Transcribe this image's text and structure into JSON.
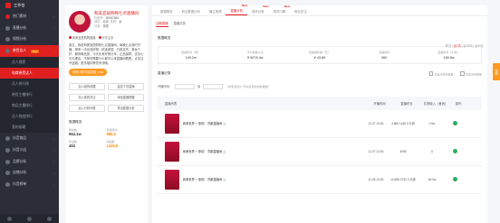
{
  "nav": {
    "title": "工作台",
    "items": [
      {
        "label": "热门素材"
      },
      {
        "label": "直播分析"
      },
      {
        "label": "视频分析"
      },
      {
        "label": "带货达人",
        "tag": "New",
        "active": true
      },
      {
        "label": "达人搜索",
        "sub": true
      },
      {
        "label": "电商带货达人",
        "sub": true,
        "active": true
      },
      {
        "label": "达人排行榜",
        "sub": true
      },
      {
        "label": "带货主播排行",
        "sub": true
      },
      {
        "label": "商品主播排行",
        "sub": true
      },
      {
        "label": "达人热度排行",
        "sub": true
      },
      {
        "label": "我的收藏",
        "sub": true
      },
      {
        "label": "抖音商品"
      },
      {
        "label": "抖音小店"
      },
      {
        "label": "品牌分析"
      },
      {
        "label": "店铺分析"
      },
      {
        "label": "抖音榜单"
      }
    ]
  },
  "profile": {
    "name": "和美宜居购物七点直播间",
    "id_label": "抖音号：",
    "id": "80987888",
    "area_label": "地区：",
    "area": "北京",
    "fans_label": "性别：",
    "fans": "女",
    "type_label": "分类：",
    "type": "家居",
    "quick": [
      "和美宜居购物直播",
      "分享主页"
    ]
  },
  "desc": "各位，我是和美宜居购物七点直播间。每晚七点准时开播，带来一手优选好物，精选家居、日用百货、美妆个护、服饰等品类，今天也有好物分享，正品保障，支持七天无理由，不管您需要什么都可以来直播间看看，点关注不迷路，更多福利等您来领哦。",
  "badge": "带货口碑 商品总数 1.3w",
  "actions": [
    "加入我的收藏",
    "监控下次直播",
    "加入我的关注",
    "添加直播提醒",
    "加入分析列表",
    "导出数据分析"
  ],
  "stats": {
    "title": "数据概览",
    "items": [
      {
        "k": "粉丝数",
        "v": "964.1w",
        "o": false
      },
      {
        "k": "直播场次",
        "v": "886.0",
        "o": true
      },
      {
        "k": "作品数",
        "v": "453",
        "o": false
      },
      {
        "k": "商品数",
        "v": "1426.9",
        "o": true
      }
    ]
  },
  "tabs": [
    {
      "label": "数据概览"
    },
    {
      "label": "粉丝数据分析"
    },
    {
      "label": "播主视频"
    },
    {
      "label": "直播分析",
      "on": true,
      "new": "New"
    },
    {
      "label": "电商分析",
      "new": "New"
    },
    {
      "label": "带货口碑",
      "new": "New"
    },
    {
      "label": "粉丝关注"
    }
  ],
  "subtabs": [
    {
      "label": "近期直播",
      "on": true
    },
    {
      "label": "直播日历"
    }
  ],
  "overview": {
    "title": "数据概览",
    "links": [
      {
        "t": "昨日"
      },
      {
        "t": "近7天",
        "r": true
      },
      {
        "t": "近30天"
      },
      {
        "t": "近90天"
      }
    ],
    "kpis": [
      {
        "k": "直播场次（场）",
        "v": "149.2w"
      },
      {
        "k": "平均观看人次",
        "v": "¥ 6078.4w"
      },
      {
        "k": "直播销售额（元）",
        "v": "¥ 43.89"
      },
      {
        "k": "直播场均",
        "v": "360"
      },
      {
        "k": "直播时长（小时）",
        "v": "136.9w"
      }
    ]
  },
  "live": {
    "title": "直播记录",
    "checks": [
      "仅显示带货直播",
      "仅显示有回放"
    ],
    "range_label": "开播时间：",
    "to": "到",
    "note": "（搜索最近6个月内任意时间的数据）"
  },
  "table": {
    "headers": [
      "直播列表",
      "开播时间",
      "直播时长",
      "礼物收入（音浪）",
      "操作"
    ],
    "rows": [
      {
        "title": "和美世界 ⚡ 惊叹！ 同款直播间",
        "time": "11-07 13:00",
        "dur": "4,585 1445 3 分钟",
        "gift": "0.5w"
      },
      {
        "title": "和美世界 ⚡ 惊叹！ 同款直播间",
        "time": "11-07 13:00",
        "dur": "4095",
        "gift": "5"
      },
      {
        "title": "和美世界 ⚡ 惊叹！ 同款直播间",
        "time": "11-05 13:00",
        "dur": "10,698 3732 3 分钟",
        "gift": "64.0w"
      }
    ]
  },
  "side_tab": "客服"
}
